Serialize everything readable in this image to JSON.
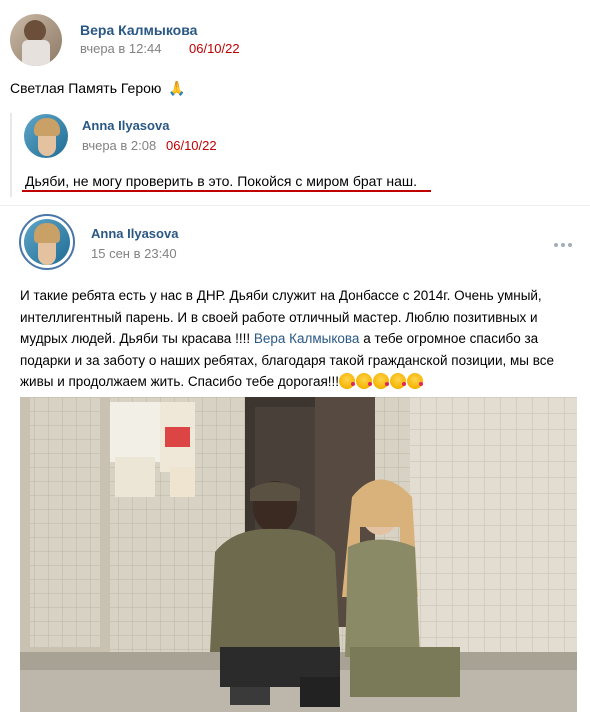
{
  "comment": {
    "author": "Вера Калмыкова",
    "time": "вчера в 12:44",
    "date_stamp": "06/10/22",
    "text": "Светлая Память Герою",
    "emoji": "🙏"
  },
  "reply": {
    "author": "Anna Ilyasova",
    "time": "вчера в 2:08",
    "date_stamp": "06/10/22",
    "text": "Дьяби, не могу проверить в это. Покойся с миром брат наш."
  },
  "post": {
    "author": "Anna Ilyasova",
    "time": "15 сен в 23:40",
    "more_icon": "more-dots-icon",
    "text_before_link": "И такие ребята есть у нас в ДНР. Дьяби служит на Донбассе с 2014г. Очень умный, интеллигентный парень. И в своей работе отличный мастер. Люблю позитивных и мудрых людей. Дьяби ты красава !!!! ",
    "link_text": "Вера Калмыкова",
    "text_after_link": " а тебе огромное спасибо за подарки и за заботу о наших ребятах, благодаря такой гражданской позиции, мы все живы и продолжаем жить. Спасибо тебе дорогая!!!",
    "emoji_count": 5
  },
  "colors": {
    "link": "#2a5885",
    "meta": "#828282",
    "annotation_red": "#c00000"
  }
}
